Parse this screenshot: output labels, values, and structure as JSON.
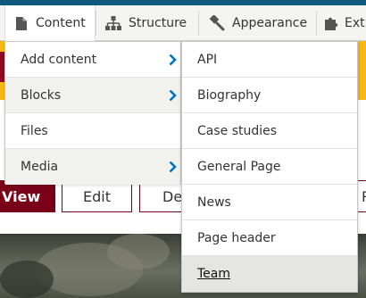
{
  "toolbar": {
    "content": "Content",
    "structure": "Structure",
    "appearance": "Appearance",
    "extend": "Ext"
  },
  "content_menu": {
    "items": [
      {
        "label": "Add content",
        "has_submenu": true
      },
      {
        "label": "Blocks",
        "has_submenu": true
      },
      {
        "label": "Files",
        "has_submenu": false
      },
      {
        "label": "Media",
        "has_submenu": true
      }
    ]
  },
  "add_content_submenu": {
    "items": [
      {
        "label": "API"
      },
      {
        "label": "Biography"
      },
      {
        "label": "Case studies"
      },
      {
        "label": "General Page"
      },
      {
        "label": "News"
      },
      {
        "label": "Page header"
      },
      {
        "label": "Team",
        "active": true
      }
    ]
  },
  "page_tabs": {
    "view": "View",
    "edit": "Edit",
    "delete": "De",
    "r": "R"
  },
  "colors": {
    "accent_blue": "#0074bd",
    "maroon": "#7a0019",
    "gold": "#f6b911",
    "toolbar_bg": "#f4f4f2"
  }
}
